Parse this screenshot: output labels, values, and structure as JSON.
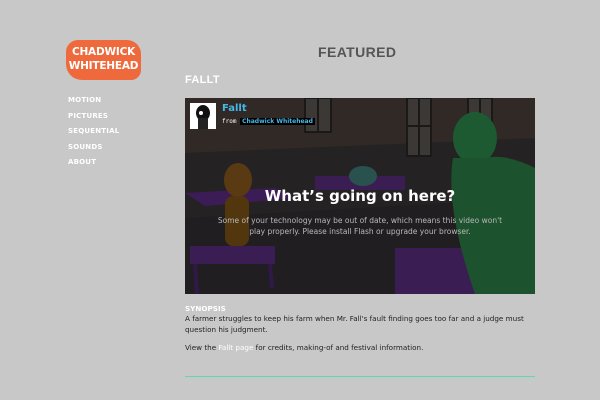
{
  "logo": {
    "line1": "CHADWICK",
    "line2": "WHITEHEAD"
  },
  "nav": [
    "MOTION",
    "PICTURES",
    "SEQUENTIAL",
    "SOUNDS",
    "ABOUT"
  ],
  "page": {
    "heading": "FEATURED",
    "subheading": "FALLT"
  },
  "video": {
    "title": "Fallt",
    "from_label": "from",
    "author": "Chadwick Whitehead",
    "message_title": "What’s going on here?",
    "message_body": "Some of your technology may be out of date, which means this video won't play properly. Please install Flash or upgrade your browser."
  },
  "synopsis": {
    "label": "SYNOPSIS",
    "text": "A farmer struggles to keep his farm when Mr. Fall's fault finding goes too far and a judge must question his judgment.",
    "view_prefix": "View the",
    "link": "Fallt page",
    "view_suffix": "for credits, making-of and festival information."
  },
  "colors": {
    "background": "#c8c8c8",
    "logo": "#ee6a3c",
    "link": "#45b8e8",
    "rule": "#5fd6b4"
  }
}
